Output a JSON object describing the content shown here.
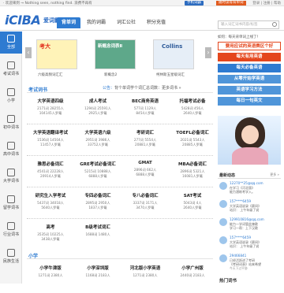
{
  "topbar": {
    "greeting": "· 欢迎来到 → Nothing seen, nothing find. 浪费不再有",
    "mobile_dict": "手机词霸",
    "random_listen": "随时读等背单词",
    "right_links": "登录 | 注册 | 帮助"
  },
  "header": {
    "logo_main": "iCIBA",
    "logo_sub": "爱词霸",
    "nav": [
      {
        "label": "背单词",
        "active": true
      },
      {
        "label": "我的词霸",
        "active": false
      },
      {
        "label": "词汇公社",
        "active": false
      },
      {
        "label": "积分充值",
        "active": false
      }
    ],
    "search_placeholder": "输入词汇词书内容/标签"
  },
  "sidebar": [
    {
      "label": "全部",
      "active": true
    },
    {
      "label": "考试词书",
      "active": false
    },
    {
      "label": "小学",
      "active": false
    },
    {
      "label": "初中词书",
      "active": false
    },
    {
      "label": "高中词书",
      "active": false
    },
    {
      "label": "大学词书",
      "active": false
    },
    {
      "label": "留学词书",
      "active": false
    },
    {
      "label": "行业词书",
      "active": false
    },
    {
      "label": "民族生活",
      "active": false
    }
  ],
  "banner": {
    "books": [
      {
        "title": "考大",
        "caption": "六级高频词汇汇"
      },
      {
        "title": "新概念词表Ⅱ",
        "caption": "新概念2"
      },
      {
        "title": "Collins",
        "caption": "柯林斯五星级词汇"
      }
    ]
  },
  "section1": {
    "title": "考试词书",
    "notice_prefix": "公告：",
    "notice": "背个单词学个词汇总词数：更多词书 »"
  },
  "exam_books": [
    {
      "title": "大学英语四级",
      "stat1": "2171词  28255人",
      "stat2": "104145人罗篭",
      "btn": "开始学习"
    },
    {
      "title": "成人考试",
      "stat1": "1294词  25591人",
      "stat2": "2925人罗篭",
      "btn": "开始学习"
    },
    {
      "title": "BEC商务英语",
      "stat1": "577词  1129人",
      "stat2": "8454人罗篭",
      "btn": "开始学习"
    },
    {
      "title": "托福考试必备",
      "stat1": "5428词  456人",
      "stat2": "2640人罗篭",
      "btn": "开始学习"
    },
    {
      "title": "大学英语翻译考试",
      "stat1": "1536词  14504人",
      "stat2": "11457人罗篭",
      "btn": "开始学习"
    },
    {
      "title": "大学英语六级",
      "stat1": "2951词  3986人",
      "stat2": "33752人罗篭",
      "btn": "开始学习"
    },
    {
      "title": "考研词汇",
      "stat1": "277词  5554人",
      "stat2": "20881人罗篭",
      "btn": "开始学习"
    },
    {
      "title": "TOEFL必备词汇",
      "stat1": "2021词  5543人",
      "stat2": "20885人罗篭",
      "btn": "开始学习"
    },
    {
      "title": "雅思必备词汇",
      "stat1": "4541词  22228人",
      "stat2": "20914人罗篭",
      "btn": "开始学习"
    },
    {
      "title": "GRE考试必备词汇",
      "stat1": "5215词  10888人",
      "stat2": "6888人罗篭",
      "btn": "开始学习"
    },
    {
      "title": "GMAT",
      "stat1": "2896词  662人",
      "stat2": "6888人罗篭",
      "btn": "开始学习"
    },
    {
      "title": "MBA必备词汇",
      "stat1": "2896词  5321人",
      "stat2": "16081人罗篭",
      "btn": "开始学习"
    },
    {
      "title": "研究生入学考试",
      "stat1": "5437词  34018人",
      "stat2": "5640人罗篭",
      "btn": "开始学习"
    },
    {
      "title": "专四必备词汇",
      "stat1": "2895词  2950人",
      "stat2": "1837人罗篭",
      "btn": "开始学习"
    },
    {
      "title": "专八必备词汇",
      "stat1": "3337词  3171人",
      "stat2": "3470人罗篭",
      "btn": "开始学习"
    },
    {
      "title": "SAT考试",
      "stat1": "5043词  4人",
      "stat2": "2640人罗篭",
      "btn": "开始学习"
    },
    {
      "title": "高考",
      "stat1": "3535词  10225人",
      "stat2": "3438人罗篭",
      "btn": "开始学习"
    },
    {
      "title": "B级考试词汇",
      "stat1": "1688词  1480人",
      "stat2": "",
      "btn": "开始学习"
    }
  ],
  "section2": {
    "title": "小学"
  },
  "primary_books": [
    {
      "title": "小学牛津版",
      "stat1": "1271词  2380人"
    },
    {
      "title": "小学深圳版",
      "stat1": "1168词  2183人"
    },
    {
      "title": "河北版小学英语",
      "stat1": "1271词  2380人"
    },
    {
      "title": "小学广州版",
      "stat1": "2440词  2183人"
    }
  ],
  "right_panel": {
    "learn_title": "如何：每天背单词上线了！",
    "pills": [
      "要用应试的英语赛区个好",
      "每天有用英语",
      "每天必备英语",
      "从零开始学英语",
      "英语学习方法",
      "每日一句英文"
    ],
    "latest_title": "最新动态",
    "latest_more": "更多 »",
    "feed": [
      {
        "user": "12270**25@qq.com",
        "msg": "在学习《河北版》",
        "msg2": "能力潜练考学入。",
        "time": ""
      },
      {
        "user": "157****6459",
        "msg": "大学英语说录《赛间》",
        "msg2": "站识： 上午年级了说",
        "time": ""
      },
      {
        "user": "129910816@qq.com",
        "msg": "能力一学词管此辣歌",
        "msg2": "学习一帮：上下汉歌",
        "time": ""
      },
      {
        "user": "157****6459",
        "msg": "大学英语说录《赛间》",
        "msg2": "站识： 上午年级了说",
        "time": ""
      },
      {
        "user": "29466841",
        "msg": "已经活跃进了考研",
        "msg2": "《考研词表》站来希望",
        "time": "今天下过平胁"
      }
    ],
    "footer_title": "热门词书"
  }
}
